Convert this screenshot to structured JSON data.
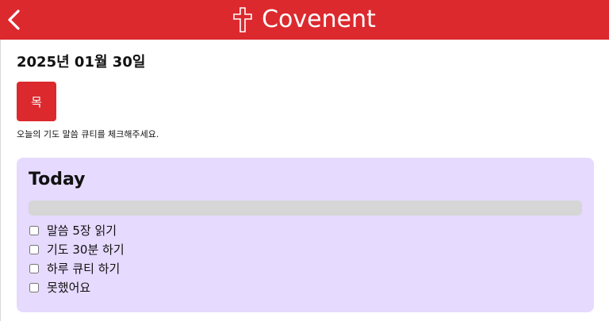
{
  "header": {
    "title": "Covenent",
    "back_icon": "chevron-left-icon",
    "brand_icon": "cross-icon",
    "color": "#dc292e"
  },
  "date": "2025년 01월 30일",
  "day_badge": "목",
  "instruction": "오늘의 기도 말씀 큐티를 체크해주세요.",
  "today": {
    "title": "Today",
    "progress": 0,
    "card_color": "#e6daff",
    "tasks": [
      {
        "label": "말씀 5장 읽기",
        "checked": false
      },
      {
        "label": "기도 30분 하기",
        "checked": false
      },
      {
        "label": "하루 큐티 하기",
        "checked": false
      },
      {
        "label": "못했어요",
        "checked": false
      }
    ]
  }
}
